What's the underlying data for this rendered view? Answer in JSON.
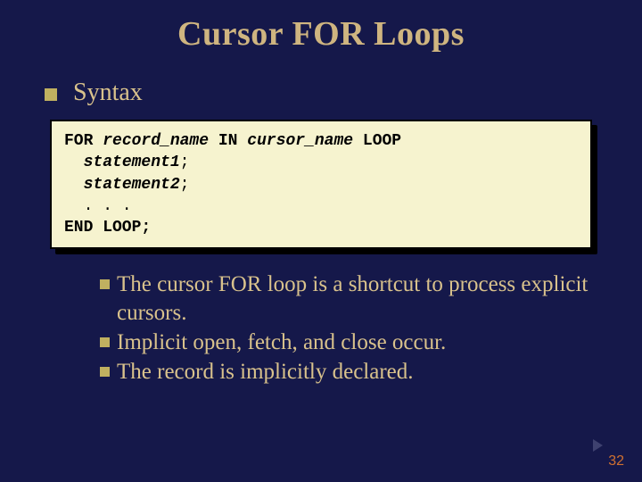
{
  "title": "Cursor FOR Loops",
  "section_label": "Syntax",
  "code": {
    "l1a": "FOR ",
    "l1b": "record_name",
    "l1c": " IN ",
    "l1d": "cursor_name",
    "l1e": " LOOP",
    "l2": "statement1",
    "l2s": ";",
    "l3": "statement2",
    "l3s": ";",
    "l4": "  . . .",
    "l5": "END LOOP;"
  },
  "bullets": [
    "The cursor FOR loop is a shortcut to process explicit cursors.",
    "Implicit open, fetch, and close occur.",
    "The record is implicitly declared."
  ],
  "page_number": "32"
}
